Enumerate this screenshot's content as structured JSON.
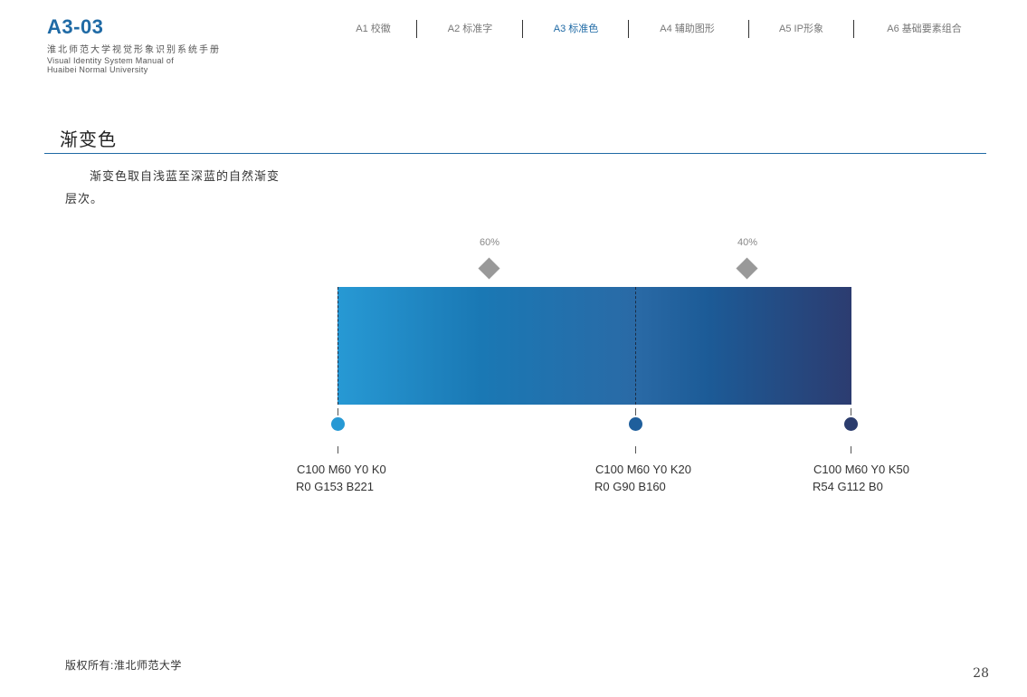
{
  "header": {
    "code": "A3-03",
    "title_cn": "淮北师范大学视觉形象识别系统手册",
    "title_en_line1": "Visual Identity System Manual of",
    "title_en_line2": "Huaibei Normal University"
  },
  "nav": {
    "items": [
      {
        "label": "A1 校徽",
        "active": false
      },
      {
        "label": "A2 标准字",
        "active": false
      },
      {
        "label": "A3 标准色",
        "active": true
      },
      {
        "label": "A4 辅助图形",
        "active": false
      },
      {
        "label": "A5 IP形象",
        "active": false
      },
      {
        "label": "A6 基础要素组合",
        "active": false
      }
    ]
  },
  "section": {
    "title": "渐变色",
    "description": "渐变色取自浅蓝至深蓝的自然渐变层次。"
  },
  "gradient": {
    "midpoints": [
      {
        "label": "60%"
      },
      {
        "label": "40%"
      }
    ],
    "stops": [
      {
        "cmyk": "C100 M60 Y0 K0",
        "rgb": "R0 G153 B221",
        "color": "#2799d4"
      },
      {
        "cmyk": "C100 M60 Y0 K20",
        "rgb": "R0 G90 B160",
        "color": "#1f5f9c"
      },
      {
        "cmyk": "C100 M60 Y0 K50",
        "rgb": "R54 G112 B0",
        "color": "#2b3c6d"
      }
    ]
  },
  "footer": {
    "copyright": "版权所有:淮北师范大学",
    "page_number": "28"
  },
  "colors": {
    "accent": "#1f6aa5",
    "rule": "#1f6aa5"
  }
}
